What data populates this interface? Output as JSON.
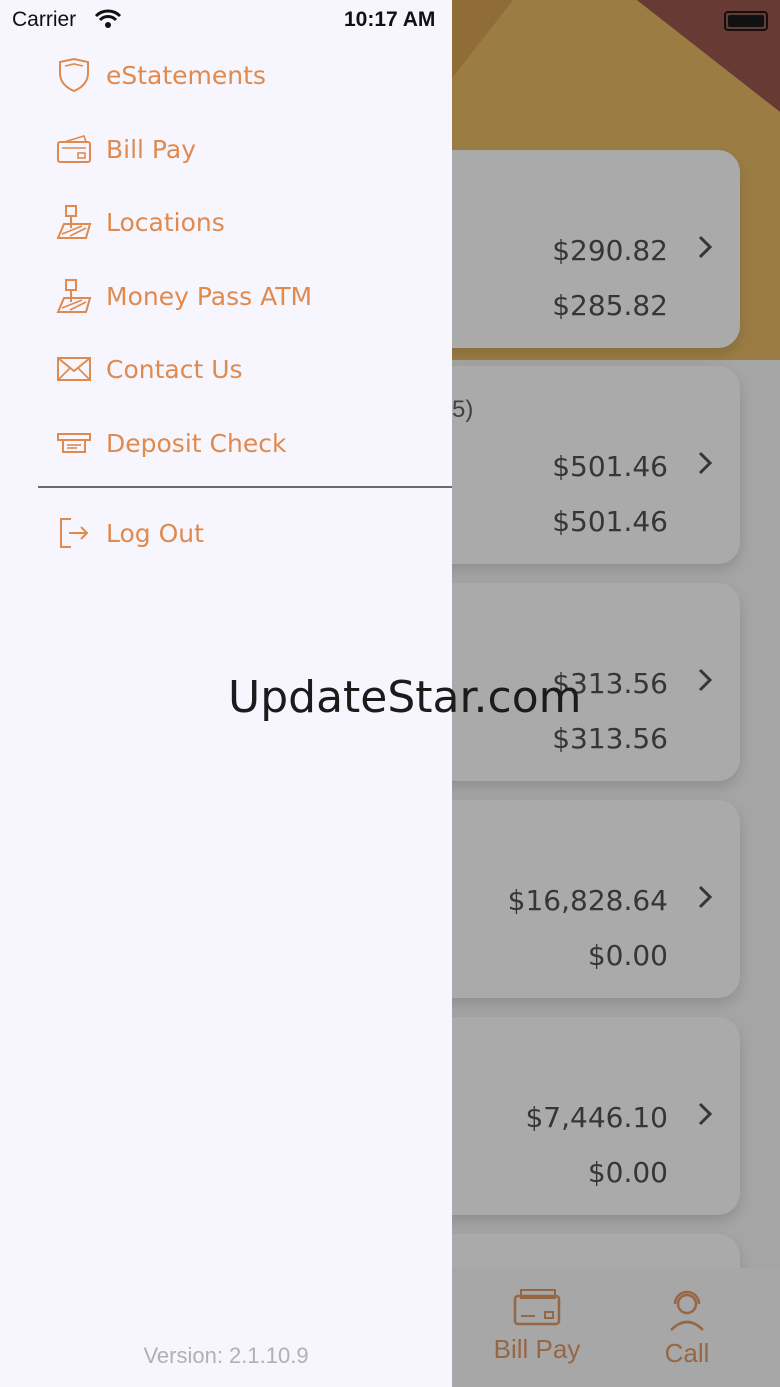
{
  "status_bar": {
    "carrier": "Carrier",
    "time": "10:17 AM"
  },
  "drawer": {
    "items": [
      {
        "label": "eStatements",
        "icon": "shield-icon"
      },
      {
        "label": "Bill Pay",
        "icon": "bill-card-icon"
      },
      {
        "label": "Locations",
        "icon": "map-pin-icon"
      },
      {
        "label": "Money Pass ATM",
        "icon": "atm-map-icon"
      },
      {
        "label": "Contact Us",
        "icon": "envelope-icon"
      },
      {
        "label": "Deposit Check",
        "icon": "check-deposit-icon"
      }
    ],
    "logout": {
      "label": "Log Out",
      "icon": "logout-icon"
    },
    "version": "Version: 2.1.10.9"
  },
  "accounts": [
    {
      "balance": "$290.82",
      "available": "$285.82",
      "partial_text": ""
    },
    {
      "balance": "$501.46",
      "available": "$501.46",
      "partial_text": "5)"
    },
    {
      "balance": "$313.56",
      "available": "$313.56",
      "partial_text": ""
    },
    {
      "balance": "$16,828.64",
      "available": "$0.00",
      "partial_text": ""
    },
    {
      "balance": "$7,446.10",
      "available": "$0.00",
      "partial_text": ""
    }
  ],
  "tab_bar": {
    "bill_pay": "Bill Pay",
    "call": "Call"
  },
  "watermark": "UpdateStar.com",
  "colors": {
    "accent": "#e08a4e",
    "drawer_bg": "#f7f5fd"
  }
}
